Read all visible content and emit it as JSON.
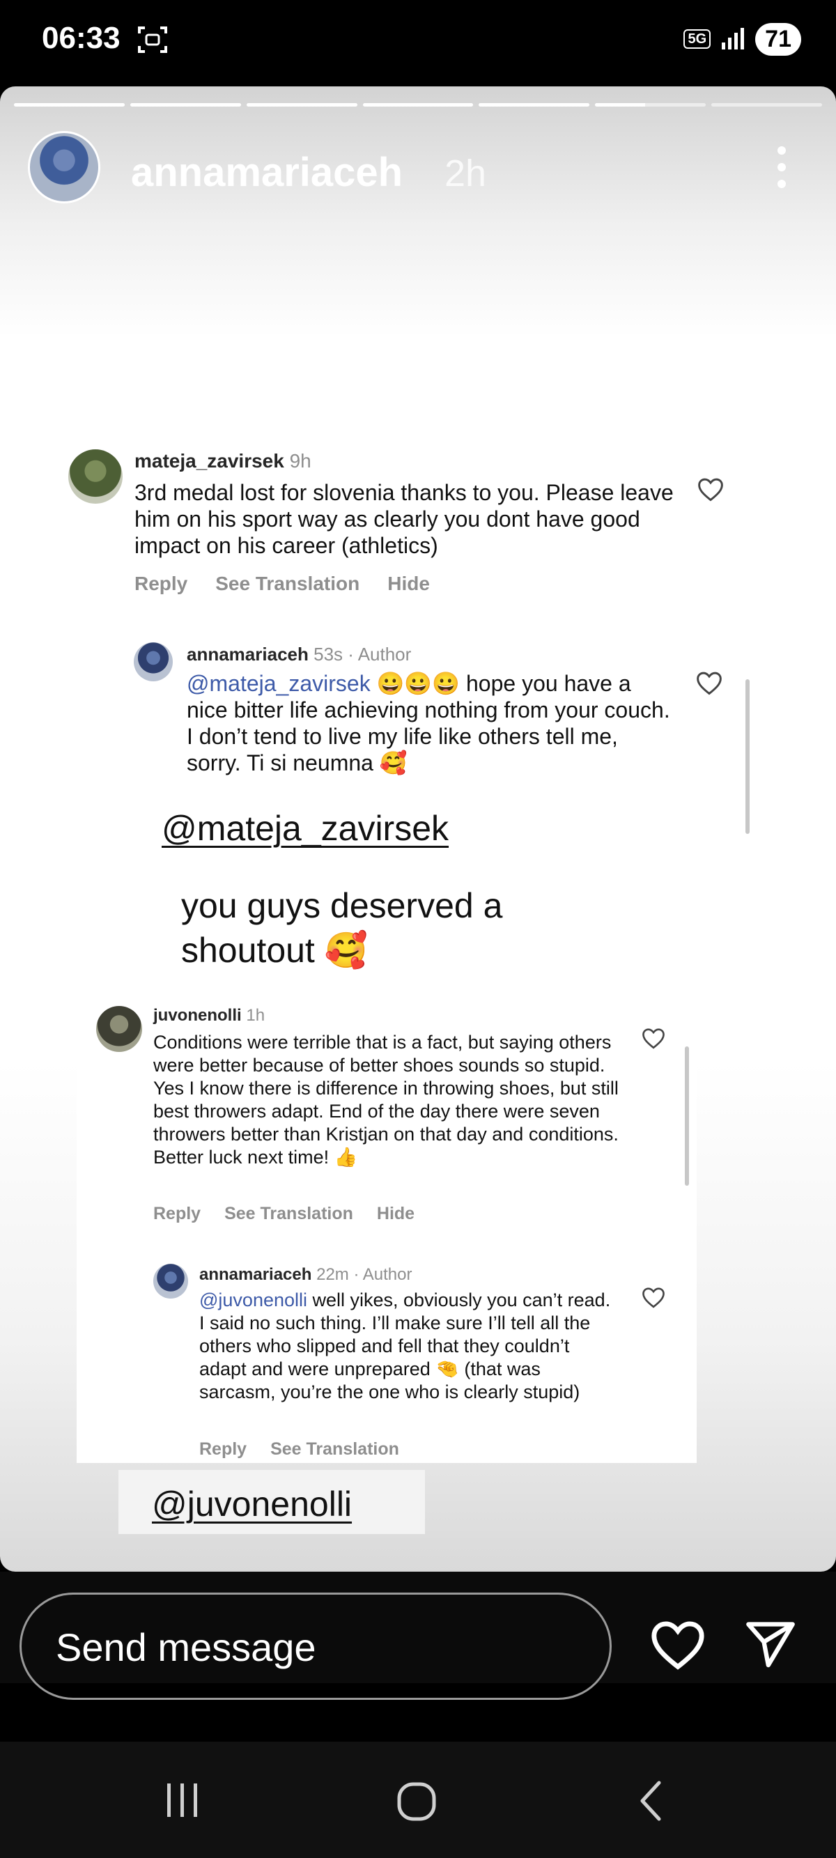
{
  "status_bar": {
    "time": "06:33",
    "network": "5G",
    "battery": "71"
  },
  "story": {
    "username": "annamariaceh",
    "time": "2h",
    "progress_segments": [
      1,
      1,
      1,
      1,
      1,
      0.45,
      0
    ]
  },
  "comments": [
    {
      "username": "mateja_zavirsek",
      "time": "9h",
      "text": "3rd medal lost for slovenia thanks to you. Please leave him on his sport way as clearly you dont have good impact on his career (athletics)",
      "actions": [
        "Reply",
        "See Translation",
        "Hide"
      ]
    },
    {
      "username": "annamariaceh",
      "meta": "53s · Author",
      "mention": "@mateja_zavirsek",
      "text": " 😀😀😀 hope you have a nice bitter life achieving nothing from your couch. I don’t tend to live my life like others tell me, sorry. Ti si neumna 🥰"
    },
    {
      "username": "juvonenolli",
      "time": "1h",
      "text": "Conditions were terrible that is a fact, but saying others were better because of better shoes sounds so stupid. Yes I know there is difference in throwing shoes, but still best throwers adapt. End of the day there were seven throwers better than Kristjan on that day and conditions. Better luck next time! 👍",
      "actions": [
        "Reply",
        "See Translation",
        "Hide"
      ]
    },
    {
      "username": "annamariaceh",
      "meta": "22m · Author",
      "mention": "@juvonenolli",
      "text": " well yikes, obviously you can’t read. I said no such thing. I’ll make sure I’ll tell all the others who slipped and fell that they couldn’t adapt and were unprepared 🤏 (that was sarcasm, you’re the one who is clearly stupid)",
      "actions": [
        "Reply",
        "See Translation"
      ]
    }
  ],
  "tags": {
    "first": "@mateja_zavirsek",
    "second": "@juvonenolli"
  },
  "shoutout": "you guys deserved a shoutout 🥰",
  "reply_bar": {
    "placeholder": "Send message"
  },
  "icons": {
    "heart": "heart-icon",
    "send": "paper-plane-icon",
    "more": "more-vertical-icon",
    "nav": [
      "recent-apps-icon",
      "home-icon",
      "back-icon"
    ]
  }
}
